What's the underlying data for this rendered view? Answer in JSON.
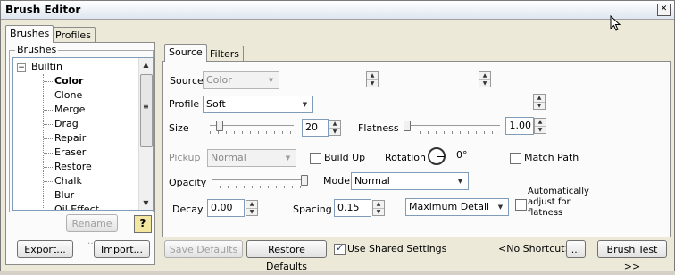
{
  "window": {
    "title": "Brush Editor",
    "close": "✕"
  },
  "top_tabs": [
    {
      "label": "Brushes"
    },
    {
      "label": "Profiles"
    }
  ],
  "brushes_group": {
    "title": "Brushes"
  },
  "tree": {
    "root": "Builtin",
    "items": [
      "Color",
      "Clone",
      "Merge",
      "Drag",
      "Repair",
      "Eraser",
      "Restore",
      "Chalk",
      "Blur",
      "Oil Effect"
    ],
    "selected": "Color"
  },
  "left_buttons": {
    "rename": "Rename ...",
    "help": "?",
    "export": "Export...",
    "import": "Import..."
  },
  "inner_tabs": [
    {
      "label": "Source"
    },
    {
      "label": "Filters"
    }
  ],
  "source": {
    "label": "Source",
    "value": "Color"
  },
  "profile": {
    "label": "Profile",
    "value": "Soft"
  },
  "size": {
    "label": "Size",
    "value": "20"
  },
  "flatness": {
    "label": "Flatness",
    "value": "1.00"
  },
  "pickup": {
    "label": "Pickup",
    "value": "Normal"
  },
  "build_up": {
    "label": "Build Up",
    "checked": false
  },
  "rotation": {
    "label": "Rotation",
    "value": "0°"
  },
  "match_path": {
    "label": "Match Path",
    "checked": false
  },
  "opacity": {
    "label": "Opacity"
  },
  "mode": {
    "label": "Mode",
    "value": "Normal"
  },
  "decay": {
    "label": "Decay",
    "value": "0.00"
  },
  "spacing": {
    "label": "Spacing",
    "value": "0.15"
  },
  "detail": {
    "value": "Maximum Detail"
  },
  "auto_adjust": {
    "label_lines": [
      "Automatically",
      "adjust for",
      "flatness"
    ],
    "checked": false
  },
  "bottom": {
    "save_defaults": "Save Defaults",
    "restore_defaults": "Restore Defaults",
    "use_shared": "Use Shared Settings",
    "use_shared_checked": true,
    "shortcut": "<No Shortcut>",
    "ellipsis": "...",
    "brush_test": "Brush Test >>"
  }
}
